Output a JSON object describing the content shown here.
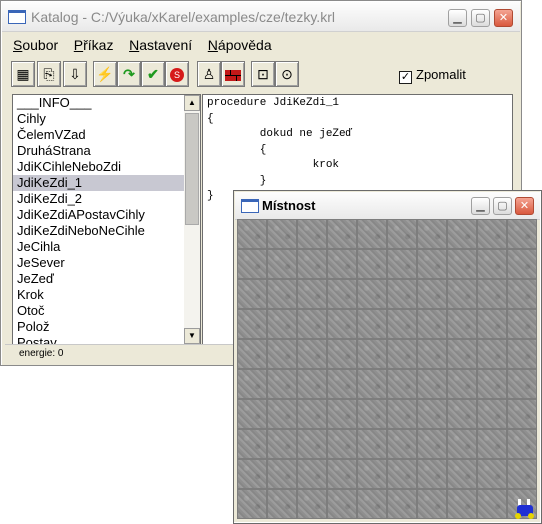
{
  "main_window": {
    "title": "Katalog - C:/Výuka/xKarel/examples/cze/tezky.krl",
    "menu": [
      {
        "access": "S",
        "rest": "oubor"
      },
      {
        "access": "P",
        "rest": "říkaz"
      },
      {
        "access": "N",
        "rest": "astavení"
      },
      {
        "access": "N",
        "rest": "ápověda"
      }
    ],
    "toolbar": {
      "zpomalit_label": "Zpomalit",
      "zpomalit_checked": "✓"
    },
    "list": {
      "items": [
        "___INFO___",
        "Cihly",
        "ČelemVZad",
        "DruháStrana",
        "JdiKCihleNeboZdi",
        "JdiKeZdi_1",
        "JdiKeZdi_2",
        "JdiKeZdiAPostavCihly",
        "JdiKeZdiNeboNeCihle",
        "JeCihla",
        "JeSever",
        "JeZeď",
        "Krok",
        "Otoč",
        "Polož",
        "Postav"
      ],
      "selected_index": 5
    },
    "code": {
      "lines": [
        "procedure JdiKeZdi_1",
        "{",
        "        dokud ne jeZeď",
        "        {",
        "                krok",
        "        }",
        "}"
      ]
    },
    "status": "energie: 0"
  },
  "room_window": {
    "title": "Místnost",
    "rows": 10,
    "cols": 10
  }
}
